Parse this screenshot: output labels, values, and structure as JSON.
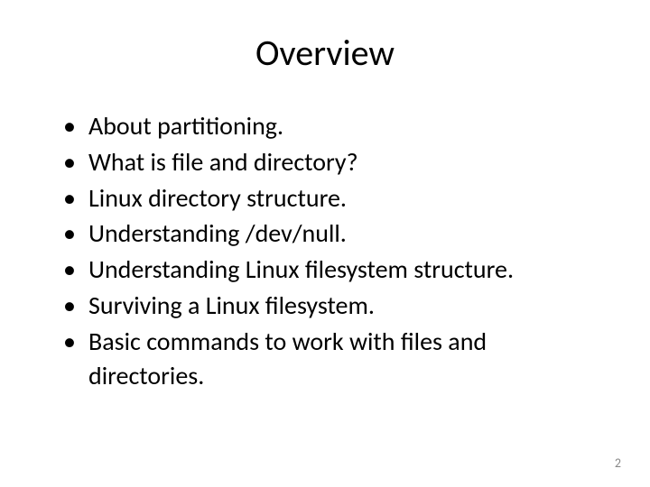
{
  "title": "Overview",
  "bullets": [
    "About partitioning.",
    "What is file and directory?",
    "Linux directory structure.",
    "Understanding /dev/null.",
    "Understanding Linux filesystem structure.",
    "Surviving a Linux filesystem.",
    "Basic commands to work with files and directories."
  ],
  "page_number": "2"
}
